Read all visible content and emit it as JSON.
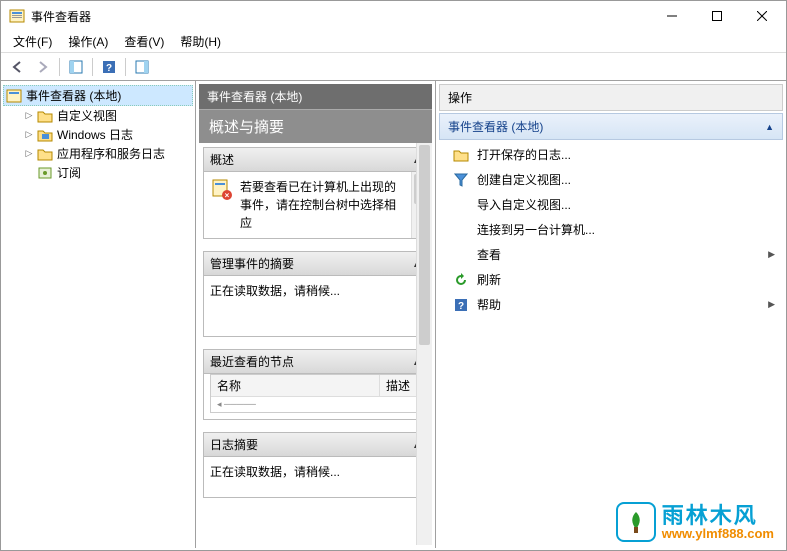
{
  "window": {
    "title": "事件查看器"
  },
  "menu": [
    "文件(F)",
    "操作(A)",
    "查看(V)",
    "帮助(H)"
  ],
  "tree": {
    "root": "事件查看器 (本地)",
    "items": [
      {
        "label": "自定义视图",
        "icon": "folder"
      },
      {
        "label": "Windows 日志",
        "icon": "folder-win"
      },
      {
        "label": "应用程序和服务日志",
        "icon": "folder"
      },
      {
        "label": "订阅",
        "icon": "subs"
      }
    ]
  },
  "center": {
    "header": "事件查看器 (本地)",
    "subheader": "概述与摘要",
    "panels": {
      "overview": {
        "title": "概述",
        "text": "若要查看已在计算机上出现的事件，请在控制台树中选择相应"
      },
      "summary": {
        "title": "管理事件的摘要",
        "text": "正在读取数据，请稍候..."
      },
      "recent": {
        "title": "最近查看的节点",
        "col1": "名称",
        "col2": "描述"
      },
      "logsum": {
        "title": "日志摘要",
        "text": "正在读取数据，请稍候..."
      }
    }
  },
  "actions": {
    "title": "操作",
    "group": "事件查看器 (本地)",
    "items": [
      {
        "label": "打开保存的日志...",
        "icon": "open"
      },
      {
        "label": "创建自定义视图...",
        "icon": "filter"
      },
      {
        "label": "导入自定义视图...",
        "icon": ""
      },
      {
        "label": "连接到另一台计算机...",
        "icon": ""
      },
      {
        "label": "查看",
        "icon": "",
        "submenu": true
      },
      {
        "label": "刷新",
        "icon": "refresh"
      },
      {
        "label": "帮助",
        "icon": "help",
        "submenu": true
      }
    ]
  },
  "watermark": {
    "cn": "雨林木风",
    "url": "www.ylmf888.com"
  }
}
